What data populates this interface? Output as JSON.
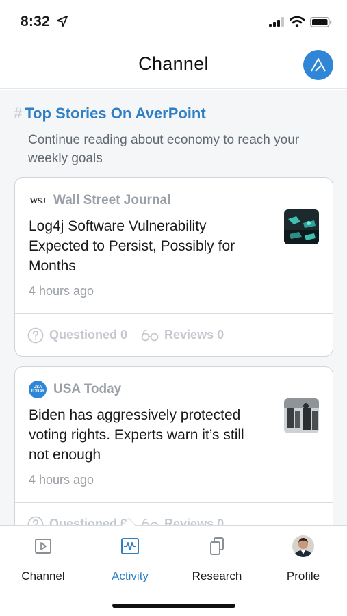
{
  "status_bar": {
    "time": "8:32"
  },
  "header": {
    "title": "Channel"
  },
  "section": {
    "hash": "#",
    "title": "Top Stories On AverPoint",
    "subtitle": "Continue reading about economy to reach your weekly goals"
  },
  "cards": [
    {
      "source": "Wall Street Journal",
      "source_icon_text": "WSJ",
      "headline": "Log4j Software Vulnerability Expected to Persist, Possibly for Months",
      "time_ago": "4 hours ago",
      "questioned": "Questioned 0",
      "reviews": "Reviews 0"
    },
    {
      "source": "USA Today",
      "source_icon_text": "USA TODAY",
      "headline": "Biden has aggressively protected voting rights. Experts warn it’s still not enough",
      "time_ago": "4 hours ago",
      "questioned": "Questioned 0",
      "reviews": "Reviews 0"
    }
  ],
  "tabs": [
    {
      "label": "Channel",
      "icon": "play-square-icon",
      "active": false
    },
    {
      "label": "Activity",
      "icon": "activity-icon",
      "active": true
    },
    {
      "label": "Research",
      "icon": "copy-icon",
      "active": false
    },
    {
      "label": "Profile",
      "icon": "avatar-icon",
      "active": false
    }
  ],
  "colors": {
    "accent": "#2f7fc4",
    "brand_circle": "#2f86d6",
    "muted": "#9aa0a6"
  }
}
